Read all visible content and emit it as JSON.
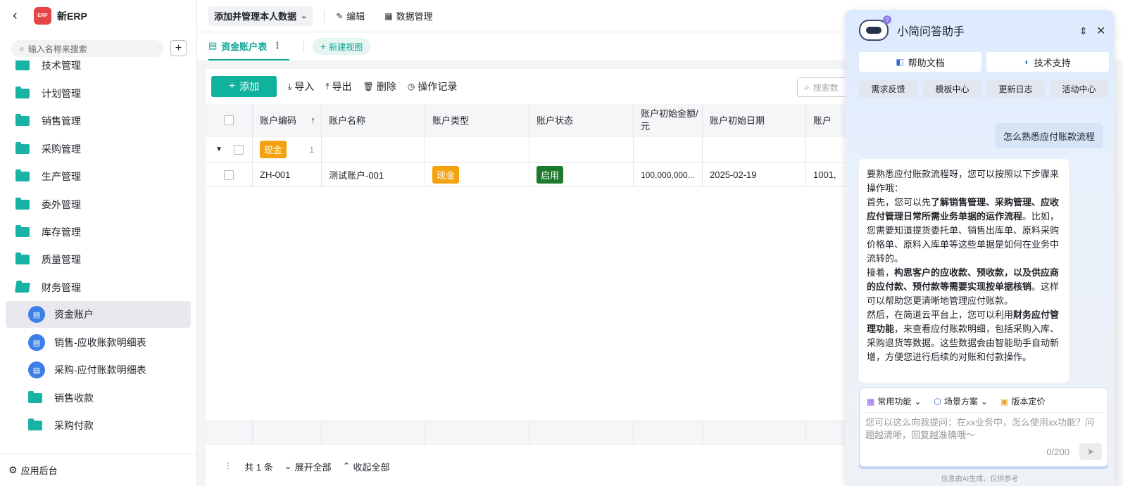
{
  "sidebar": {
    "back": "‹",
    "logo_text": "ERP",
    "app_name": "新ERP",
    "search_placeholder": "输入名称来搜索",
    "add": "+",
    "items": [
      {
        "label": "技术管理"
      },
      {
        "label": "计划管理"
      },
      {
        "label": "销售管理"
      },
      {
        "label": "采购管理"
      },
      {
        "label": "生产管理"
      },
      {
        "label": "委外管理"
      },
      {
        "label": "库存管理"
      },
      {
        "label": "质量管理"
      },
      {
        "label": "财务管理"
      }
    ],
    "sub_items": [
      {
        "label": "资金账户"
      },
      {
        "label": "销售-应收账款明细表"
      },
      {
        "label": "采购-应付账款明细表"
      },
      {
        "label": "销售收款"
      },
      {
        "label": "采购付款"
      }
    ],
    "footer": "应用后台"
  },
  "topbar": {
    "scope": "添加并管理本人数据",
    "edit": "编辑",
    "data_manage": "数据管理"
  },
  "tabbar": {
    "active_tab": "资金账户表",
    "new_view": "新建视图"
  },
  "toolbar": {
    "add": "添加",
    "import": "导入",
    "export": "导出",
    "delete": "删除",
    "log": "操作记录",
    "search_placeholder": "搜索数"
  },
  "table": {
    "headers": [
      "账户编码",
      "账户名称",
      "账户类型",
      "账户状态",
      "账户初始金额/元",
      "账户初始日期",
      "账户"
    ],
    "group": {
      "label": "现金",
      "count": "1"
    },
    "rows": [
      {
        "code": "ZH-001",
        "name": "测试账户-001",
        "type": "现金",
        "status": "启用",
        "amount": "100,000,000...",
        "date": "2025-02-19",
        "extra": "1001,"
      }
    ],
    "status": {
      "total": "共 1 条",
      "expand": "展开全部",
      "collapse": "收起全部"
    }
  },
  "assistant": {
    "title": "小简问答助手",
    "badge": "?",
    "btn_help": "帮助文档",
    "btn_support": "技术支持",
    "small": [
      "需求反馈",
      "模板中心",
      "更新日志",
      "活动中心"
    ],
    "question": "怎么熟悉应付账款流程",
    "answer": {
      "p1": "要熟悉应付账款流程呀，您可以按照以下步骤来操作哦：",
      "p2a": "首先，您可以先",
      "p2b": "了解销售管理、采购管理、应收应付管理日常所需业务单据的运作流程",
      "p2c": "。比如，您需要知道提货委托单、销售出库单、原料采购价格单、原料入库单等这些单据是如何在业务中流转的。",
      "p3a": "接着，",
      "p3b": "构思客户的应收款、预收款，以及供应商的应付款、预付款等需要实现按单据核销",
      "p3c": "。这样可以帮助您更清晰地管理应付账款。",
      "p4a": "然后，在简道云平台上，您可以利用",
      "p4b": "财务应付管理功能",
      "p4c": "，来查看应付账款明细，包括采购入库、采购退货等数据。这些数据会由智能助手自动新增，方便您进行后续的对账和付款操作。"
    },
    "tools": [
      "常用功能",
      "场景方案",
      "版本定价"
    ],
    "placeholder": "您可以这么向我提问：在xx业务中，怎么使用xx功能？问题越清晰，回复越准确哦～",
    "count": "0/200",
    "disclaimer": "信息由AI生成，仅供参考"
  },
  "colors": {
    "accent": "#11b29d",
    "cash": "#f4a310",
    "enabled": "#1d7a2d",
    "doc_icon": "#3c7fe6"
  }
}
